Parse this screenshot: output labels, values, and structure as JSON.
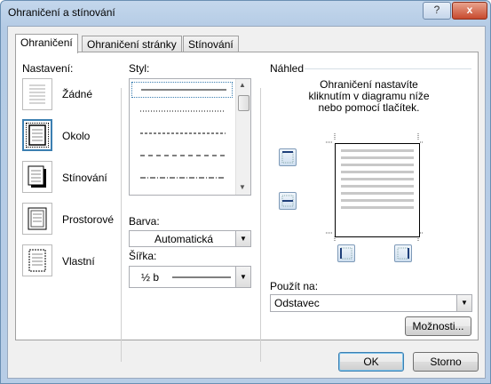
{
  "window": {
    "title": "Ohraničení a stínování",
    "help_label": "?",
    "close_label": "x"
  },
  "tabs": [
    {
      "label": "Ohraničení",
      "active": true
    },
    {
      "label": "Ohraničení stránky",
      "active": false
    },
    {
      "label": "Stínování",
      "active": false
    }
  ],
  "settings": {
    "heading": "Nastavení:",
    "items": [
      {
        "label": "Žádné",
        "icon": "none-border-icon"
      },
      {
        "label": "Okolo",
        "icon": "box-border-icon",
        "selected": true
      },
      {
        "label": "Stínování",
        "icon": "shadow-border-icon"
      },
      {
        "label": "Prostorové",
        "icon": "3d-border-icon"
      },
      {
        "label": "Vlastní",
        "icon": "custom-border-icon"
      }
    ]
  },
  "style": {
    "label": "Styl:",
    "items": [
      "solid",
      "dotted",
      "dashed-small",
      "dashed",
      "dash-dot"
    ],
    "selected_index": 0
  },
  "color": {
    "label": "Barva:",
    "value": "Automatická"
  },
  "width": {
    "label": "Šířka:",
    "value": "½ b"
  },
  "preview": {
    "label": "Náhled",
    "hint_lines": [
      "Ohraničení nastavíte",
      "kliknutím v diagramu níže",
      "nebo pomocí tlačítek."
    ]
  },
  "apply_to": {
    "label": "Použít na:",
    "value": "Odstavec"
  },
  "buttons": {
    "options": "Možnosti...",
    "ok": "OK",
    "cancel": "Storno"
  },
  "colors": {
    "title_bar": "#b9cfe7",
    "accent": "#3c7fb1",
    "dialog_bg": "#f0f0f0"
  }
}
